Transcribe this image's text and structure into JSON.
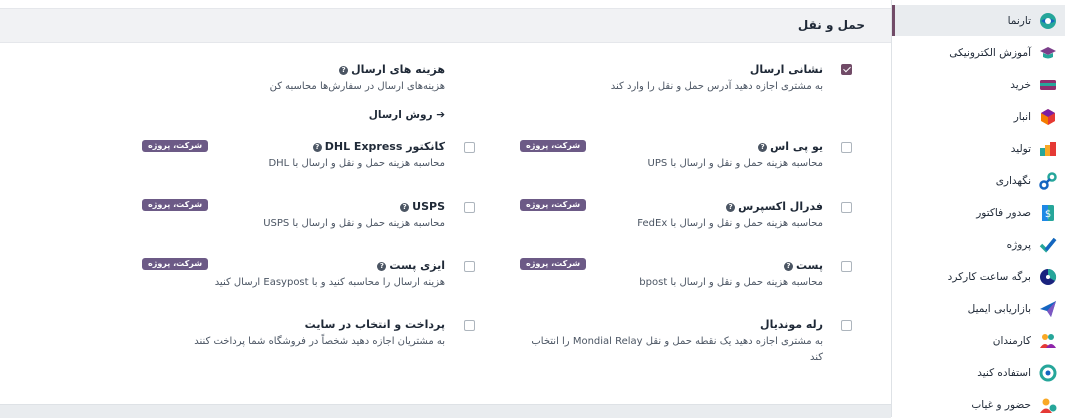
{
  "header": {
    "title": "حمل و نقل"
  },
  "sidebar": {
    "items": [
      {
        "label": "تارنما",
        "icon": "website-icon",
        "active": true
      },
      {
        "label": "آموزش الکترونیکی",
        "icon": "elearning-icon"
      },
      {
        "label": "خرید",
        "icon": "purchase-icon"
      },
      {
        "label": "انبار",
        "icon": "inventory-icon"
      },
      {
        "label": "تولید",
        "icon": "manufacturing-icon"
      },
      {
        "label": "نگهداری",
        "icon": "maintenance-icon"
      },
      {
        "label": "صدور فاکتور",
        "icon": "invoicing-icon"
      },
      {
        "label": "پروژه",
        "icon": "project-icon"
      },
      {
        "label": "برگه ساعت کارکرد",
        "icon": "timesheet-icon"
      },
      {
        "label": "بازاریابی ایمیل",
        "icon": "email-marketing-icon"
      },
      {
        "label": "کارمندان",
        "icon": "employees-icon"
      },
      {
        "label": "استفاده کنید",
        "icon": "recruitment-icon"
      },
      {
        "label": "حضور و غیاب",
        "icon": "attendance-icon"
      }
    ]
  },
  "settings": {
    "shipping_address": {
      "label": "نشانی ارسال",
      "desc": "به مشتری اجازه دهید آدرس حمل و نقل را وارد کند",
      "checked": true
    },
    "shipping_costs": {
      "label": "هزینه های ارسال",
      "desc": "هزینه‌های ارسال در سفارش‌ها محاسبه کن",
      "link": "روش ارسال"
    },
    "ups": {
      "label": "یو پی اس",
      "desc": "محاسبه هزینه حمل و نقل و ارسال با UPS",
      "badge": "شرکت، پروژه"
    },
    "dhl": {
      "label": "کانکتور DHL Express",
      "desc": "محاسبه هزینه حمل و نقل و ارسال با DHL",
      "badge": "شرکت، پروژه"
    },
    "fedex": {
      "label": "فدرال اکسپرس",
      "desc": "محاسبه هزینه حمل و نقل و ارسال با FedEx",
      "badge": "شرکت، پروژه"
    },
    "usps": {
      "label": "USPS",
      "desc": "محاسبه هزینه حمل و نقل و ارسال با USPS",
      "badge": "شرکت، پروژه"
    },
    "bpost": {
      "label": "پست",
      "desc": "محاسبه هزینه حمل و نقل و ارسال با bpost",
      "badge": "شرکت، پروژه"
    },
    "easypost": {
      "label": "ایزی پست",
      "desc": "هزینه ارسال را محاسبه کنید و با Easypost ارسال کنید",
      "badge": "شرکت، پروژه"
    },
    "mondial": {
      "label": "رله موندیال",
      "desc_line1": "به مشتری اجازه دهید یک نقطه حمل و نقل Mondial Relay را انتخاب",
      "desc_line2": "کند"
    },
    "onsite": {
      "label": "پرداخت و انتخاب در سایت",
      "desc": "به مشتریان اجازه دهید شخصاً در فروشگاه شما پرداخت کنند"
    }
  },
  "colors": {
    "accent": "#714b67",
    "badge": "#6c5a86",
    "header_bg": "#f1f2f4"
  }
}
